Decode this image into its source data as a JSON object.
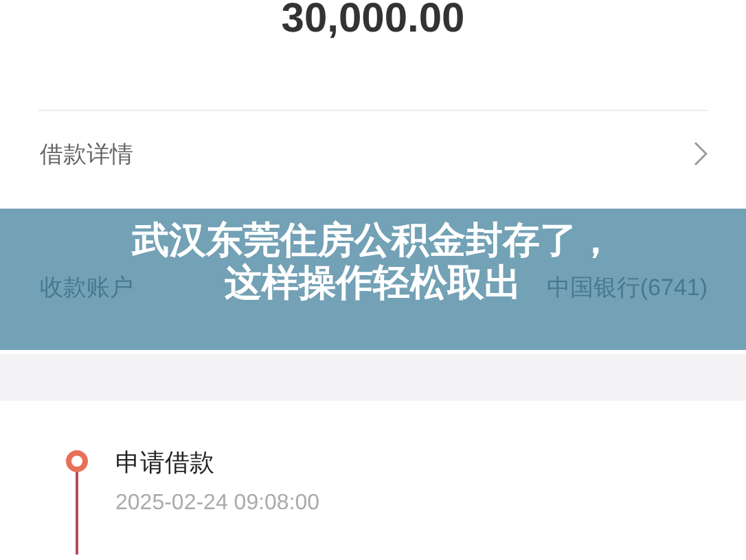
{
  "amount": "30,000.00",
  "rows": [
    {
      "kind": "link",
      "label": "借款详情"
    },
    {
      "kind": "value",
      "label": "收款账户",
      "value": "中国银行(6741)"
    }
  ],
  "banner": {
    "lines": [
      "武汉东莞住房公积金封存了，",
      "这样操作轻松取出"
    ]
  },
  "timeline": [
    {
      "title": "申请借款",
      "time": "2025-02-24 09:08:00"
    }
  ]
}
